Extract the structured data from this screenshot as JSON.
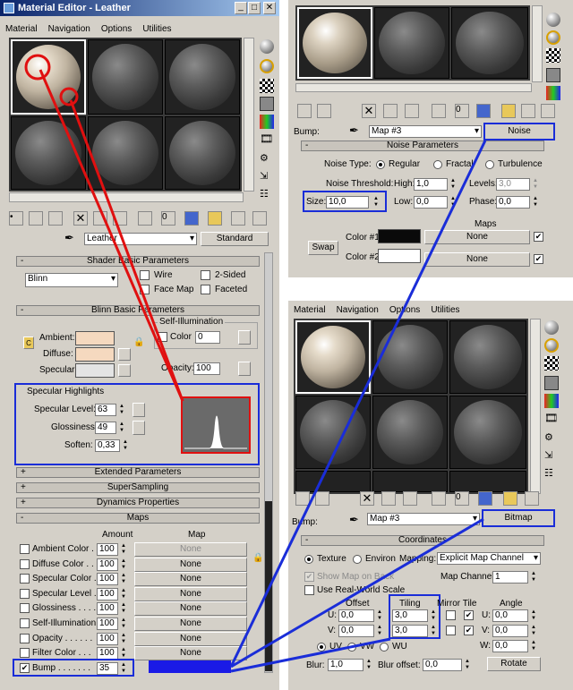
{
  "panel1": {
    "window_title": "Material Editor - Leather",
    "menu": [
      "Material",
      "Navigation",
      "Options",
      "Utilities"
    ],
    "mat_name": "Leather",
    "type_btn": "Standard",
    "shader_hdr": "Shader Basic Parameters",
    "shader": "Blinn",
    "wire": "Wire",
    "two_sided": "2-Sided",
    "face_map": "Face Map",
    "faceted": "Faceted",
    "blinn_hdr": "Blinn Basic Parameters",
    "self_illum": "Self-Illumination",
    "color_lbl": "Color",
    "color_val": "0",
    "ambient": "Ambient:",
    "diffuse": "Diffuse:",
    "specular": "Specular:",
    "opacity": "Opacity:",
    "opacity_val": "100",
    "spec_hl": "Specular Highlights",
    "spec_level": "Specular Level:",
    "spec_level_val": "63",
    "glossiness": "Glossiness:",
    "gloss_val": "49",
    "soften": "Soften:",
    "soften_val": "0,33",
    "extended": "Extended Parameters",
    "supersampling": "SuperSampling",
    "dynamics": "Dynamics Properties",
    "maps_hdr": "Maps",
    "amount_col": "Amount",
    "map_col": "Map",
    "maps": [
      {
        "name": "Ambient Color . .",
        "amount": "100",
        "map": "None"
      },
      {
        "name": "Diffuse Color . . .",
        "amount": "100",
        "map": "None"
      },
      {
        "name": "Specular Color . .",
        "amount": "100",
        "map": "None"
      },
      {
        "name": "Specular Level . .",
        "amount": "100",
        "map": "None"
      },
      {
        "name": "Glossiness . . . .",
        "amount": "100",
        "map": "None"
      },
      {
        "name": "Self-Illumination .",
        "amount": "100",
        "map": "None"
      },
      {
        "name": "Opacity . . . . . .",
        "amount": "100",
        "map": "None"
      },
      {
        "name": "Filter Color . . .",
        "amount": "100",
        "map": "None"
      },
      {
        "name": "Bump . . . . . . .",
        "amount": "35",
        "map": ""
      }
    ],
    "bump_check": "✔"
  },
  "panel2": {
    "bump_lbl": "Bump:",
    "map_name": "Map #3",
    "type_btn": "Noise",
    "noise_hdr": "Noise Parameters",
    "noise_type": "Noise Type:",
    "regular": "Regular",
    "fractal": "Fractal",
    "turbulence": "Turbulence",
    "threshold": "Noise Threshold:",
    "high": "High:",
    "high_val": "1,0",
    "levels": "Levels:",
    "levels_val": "3,0",
    "size": "Size:",
    "size_val": "10,0",
    "low": "Low:",
    "low_val": "0,0",
    "phase": "Phase:",
    "phase_val": "0,0",
    "maps": "Maps",
    "swap": "Swap",
    "color1": "Color #1",
    "color2": "Color #2",
    "none1": "None",
    "none2": "None"
  },
  "panel3": {
    "menu": [
      "Material",
      "Navigation",
      "Options",
      "Utilities"
    ],
    "bump_lbl": "Bump:",
    "map_name": "Map #3",
    "type_btn": "Bitmap",
    "coords_hdr": "Coordinates",
    "texture": "Texture",
    "environ": "Environ",
    "mapping": "Mapping:",
    "mapping_val": "Explicit Map Channel",
    "show_map": "Show Map on Back",
    "map_channel": "Map Channel:",
    "map_channel_val": "1",
    "real_world": "Use Real-World Scale",
    "offset": "Offset",
    "tiling": "Tiling",
    "mirror_tile": "Mirror Tile",
    "angle": "Angle",
    "u": "U:",
    "v": "V:",
    "w": "W:",
    "u_off": "0,0",
    "v_off": "0,0",
    "u_tile": "3,0",
    "v_tile": "3,0",
    "u_ang": "0,0",
    "v_ang": "0,0",
    "w_ang": "0,0",
    "uv": "UV",
    "vw": "VW",
    "wu": "WU",
    "blur": "Blur:",
    "blur_val": "1,0",
    "blur_off": "Blur offset:",
    "blur_off_val": "0,0",
    "rotate": "Rotate",
    "tick": "✔"
  },
  "colors": {
    "highlight": "#1a2dd8",
    "red": "#e01010",
    "leather": "#f5d9bf"
  }
}
